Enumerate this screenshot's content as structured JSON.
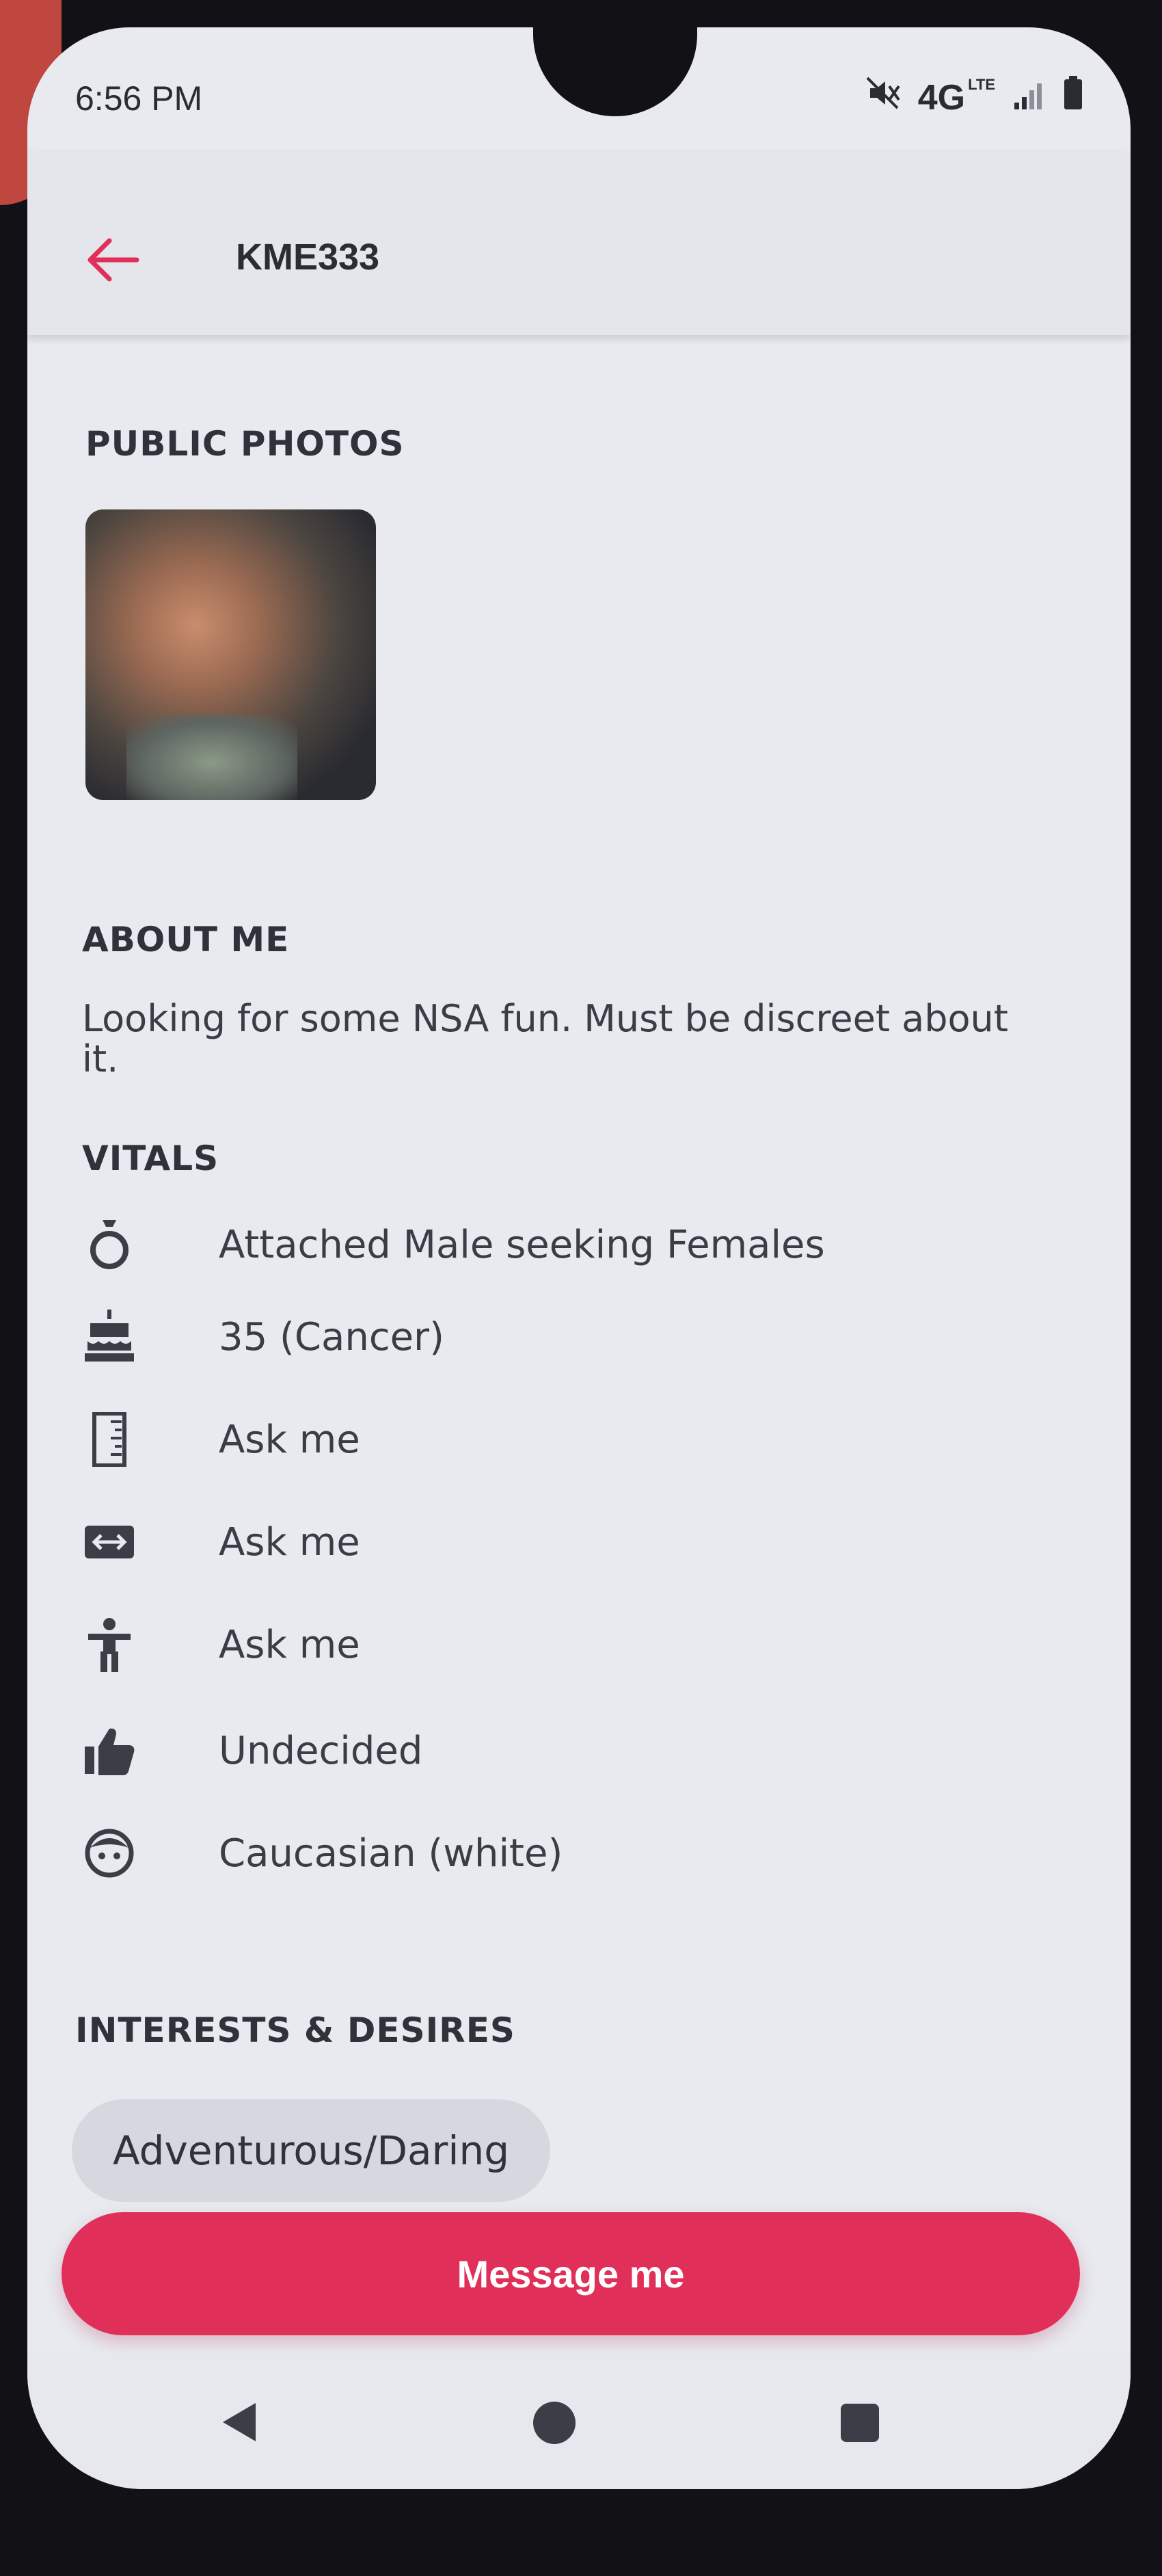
{
  "status_bar": {
    "time": "6:56 PM",
    "network": "4G",
    "network_sub": "LTE"
  },
  "app_bar": {
    "title": "KME333",
    "back_icon": "arrow-left-icon",
    "accent_color": "#e0305a"
  },
  "sections": {
    "photos_heading": "PUBLIC PHOTOS",
    "about_heading": "ABOUT ME",
    "about_text": "Looking for some NSA fun. Must be discreet about it.",
    "vitals_heading": "VITALS",
    "interests_heading": "INTERESTS & DESIRES"
  },
  "vitals": [
    {
      "icon": "ring-icon",
      "text": "Attached Male seeking Females"
    },
    {
      "icon": "birthday-cake-icon",
      "text": "35 (Cancer)"
    },
    {
      "icon": "ruler-icon",
      "text": "Ask me"
    },
    {
      "icon": "width-arrows-icon",
      "text": "Ask me"
    },
    {
      "icon": "body-figure-icon",
      "text": "Ask me"
    },
    {
      "icon": "thumbs-up-icon",
      "text": "Undecided"
    },
    {
      "icon": "face-icon",
      "text": "Caucasian (white)"
    }
  ],
  "interests": [
    "Adventurous/Daring"
  ],
  "actions": {
    "message_label": "Message me"
  },
  "nav": {
    "back_icon": "nav-back-icon",
    "home_icon": "nav-home-icon",
    "recents_icon": "nav-recents-icon"
  }
}
